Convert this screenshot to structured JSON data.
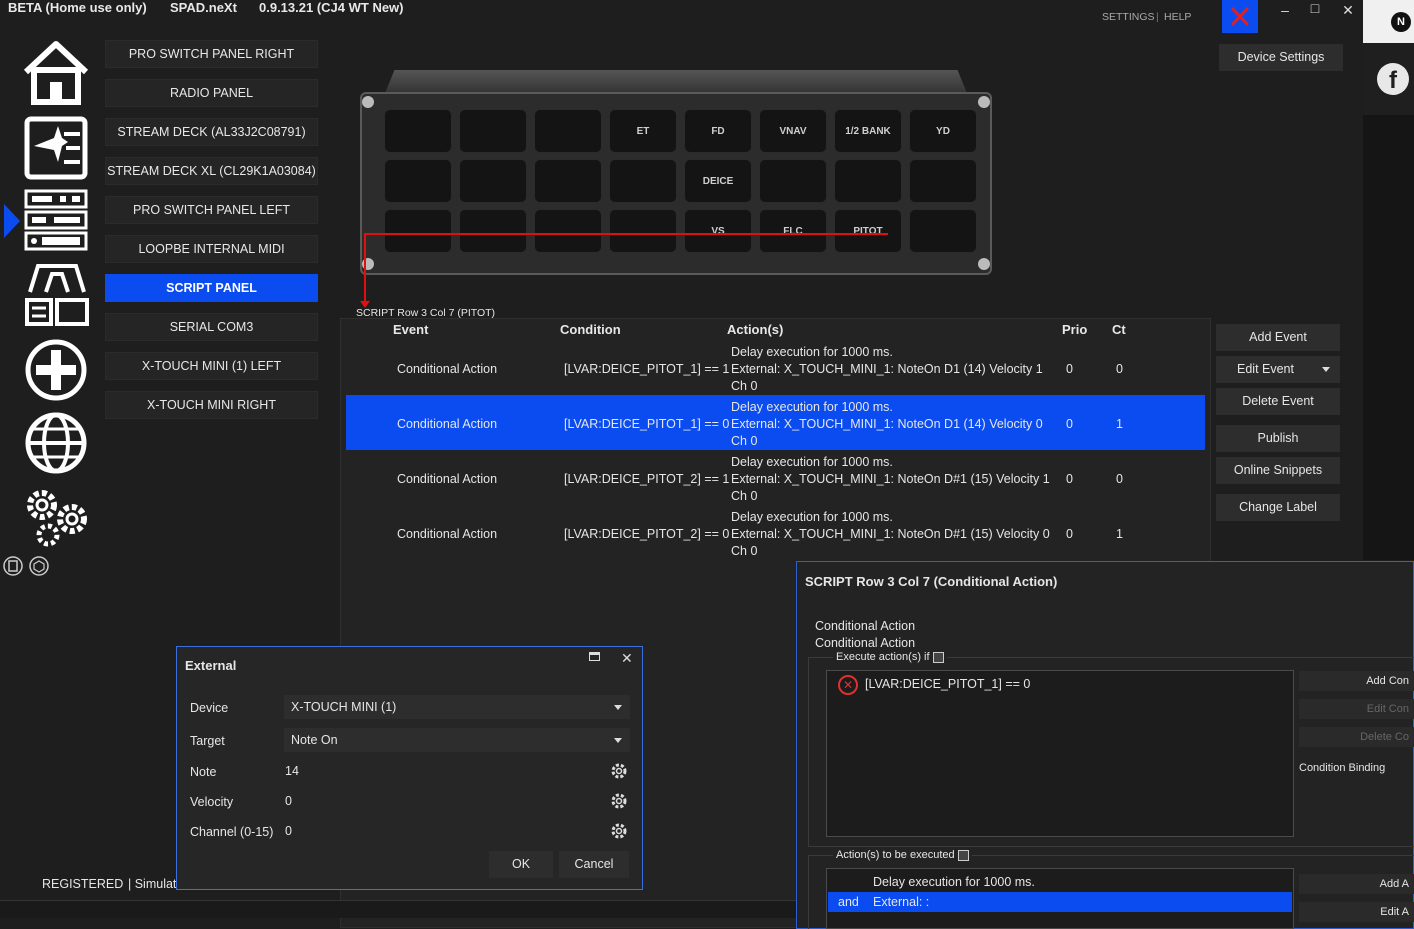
{
  "titlebar": {
    "edition": "BETA (Home use only)",
    "app": "SPAD.neXt",
    "version": "0.9.13.21 (CJ4 WT New)",
    "settings": "SETTINGS",
    "sep": "|",
    "help": "HELP",
    "minimize": "–",
    "maximize": "□",
    "close": "✕"
  },
  "device_settings": "Device Settings",
  "nav_items": [
    "PRO SWITCH PANEL RIGHT",
    "RADIO PANEL",
    "STREAM DECK (AL33J2C08791)",
    "STREAM DECK XL (CL29K1A03084)",
    "PRO SWITCH PANEL LEFT",
    "LOOPBE INTERNAL MIDI",
    "SCRIPT PANEL",
    "SERIAL COM3",
    "X-TOUCH MINI (1) LEFT",
    "X-TOUCH MINI RIGHT"
  ],
  "panel_keys": {
    "row1": [
      "",
      "",
      "",
      "ET",
      "FD",
      "VNAV",
      "1/2 BANK",
      "YD"
    ],
    "row2": [
      "",
      "",
      "",
      "",
      "DEICE",
      "",
      "",
      ""
    ],
    "row3": [
      "",
      "",
      "",
      "",
      "VS",
      "FLC",
      "PITOT",
      ""
    ]
  },
  "selected_key_label": "SCRIPT Row 3 Col 7 (PITOT)",
  "events_table": {
    "headers": {
      "event": "Event",
      "condition": "Condition",
      "actions": "Action(s)",
      "prio": "Prio",
      "ct": "Ct"
    },
    "rows": [
      {
        "event": "Conditional Action",
        "condition": "[LVAR:DEICE_PITOT_1] == 1",
        "a1": "Delay execution for 1000 ms.",
        "a2": "External: X_TOUCH_MINI_1: NoteOn D1 (14) Velocity 1",
        "a3": "Ch 0",
        "prio": "0",
        "ct": "0"
      },
      {
        "event": "Conditional Action",
        "condition": "[LVAR:DEICE_PITOT_1] == 0",
        "a1": "Delay execution for 1000 ms.",
        "a2": "External: X_TOUCH_MINI_1: NoteOn D1 (14) Velocity 0",
        "a3": "Ch 0",
        "prio": "0",
        "ct": "1"
      },
      {
        "event": "Conditional Action",
        "condition": "[LVAR:DEICE_PITOT_2] == 1",
        "a1": "Delay execution for 1000 ms.",
        "a2": "External: X_TOUCH_MINI_1: NoteOn D#1 (15) Velocity 1",
        "a3": "Ch 0",
        "prio": "0",
        "ct": "0"
      },
      {
        "event": "Conditional Action",
        "condition": "[LVAR:DEICE_PITOT_2] == 0",
        "a1": "Delay execution for 1000 ms.",
        "a2": "External: X_TOUCH_MINI_1: NoteOn D#1 (15) Velocity 0",
        "a3": "Ch 0",
        "prio": "0",
        "ct": "1"
      }
    ]
  },
  "side_buttons": {
    "add_event": "Add Event",
    "edit_event": "Edit Event",
    "delete_event": "Delete Event",
    "publish": "Publish",
    "online_snippets": "Online Snippets",
    "change_label": "Change Label"
  },
  "status": {
    "registered": "REGISTERED",
    "simulator": "| Simulat"
  },
  "external_dialog": {
    "title": "External",
    "device_label": "Device",
    "device_value": "X-TOUCH MINI (1)",
    "target_label": "Target",
    "target_value": "Note On",
    "note_label": "Note",
    "note_value": "14",
    "velocity_label": "Velocity",
    "velocity_value": "0",
    "channel_label": "Channel (0-15)",
    "channel_value": "0",
    "ok": "OK",
    "cancel": "Cancel"
  },
  "action_dialog": {
    "title": "SCRIPT Row 3 Col 7 (Conditional Action)",
    "line1": "Conditional Action",
    "line2": "Conditional Action",
    "execute_if": "Execute action(s) if",
    "condition": "[LVAR:DEICE_PITOT_1] == 0",
    "add_condition": "Add Con",
    "edit_condition": "Edit Con",
    "delete_condition": "Delete Co",
    "condition_binding": "Condition Binding",
    "actions_label": "Action(s) to be executed",
    "action1": "Delay execution for 1000 ms.",
    "action2_prefix": "and",
    "action2": "External: :",
    "add_action": "Add A",
    "edit_action": "Edit A"
  },
  "colors": {
    "accent": "#0a4cf0",
    "bg": "#1e1e1e",
    "panel": "#252525",
    "red_line": "#e01010"
  }
}
